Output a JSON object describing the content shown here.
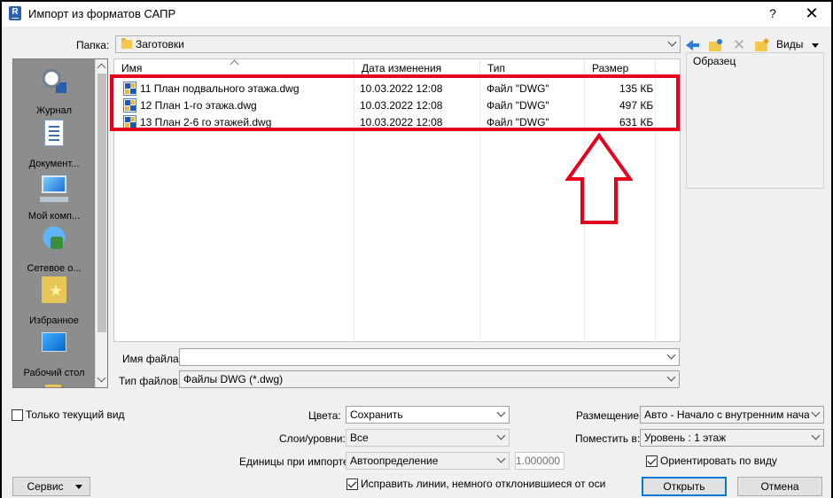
{
  "window": {
    "title": "Импорт из форматов САПР",
    "app_icon_letter": "R",
    "help_symbol": "?",
    "close_symbol": "✕"
  },
  "folder_bar": {
    "label": "Папка:",
    "value": "Заготовки",
    "views_label": "Виды"
  },
  "places": [
    {
      "label": "Журнал",
      "icon": "history-icon"
    },
    {
      "label": "Документ...",
      "icon": "documents-icon"
    },
    {
      "label": "Мой комп...",
      "icon": "computer-icon"
    },
    {
      "label": "Сетевое о...",
      "icon": "network-icon"
    },
    {
      "label": "Избранное",
      "icon": "favorites-icon"
    },
    {
      "label": "Рабочий стол",
      "icon": "desktop-icon"
    }
  ],
  "file_list": {
    "columns": [
      "Имя",
      "Дата изменения",
      "Тип",
      "Размер"
    ],
    "rows": [
      {
        "name": "11 План подвального этажа.dwg",
        "date": "10.03.2022 12:08",
        "type": "Файл \"DWG\"",
        "size": "135 КБ"
      },
      {
        "name": "12 План 1-го этажа.dwg",
        "date": "10.03.2022 12:08",
        "type": "Файл \"DWG\"",
        "size": "497 КБ"
      },
      {
        "name": "13 План 2-6 го этажей.dwg",
        "date": "10.03.2022 12:08",
        "type": "Файл \"DWG\"",
        "size": "631 КБ"
      }
    ]
  },
  "preview": {
    "label": "Образец"
  },
  "filename": {
    "label": "Имя файла:",
    "value": ""
  },
  "filetype": {
    "label": "Тип файлов:",
    "value": "Файлы DWG  (*.dwg)"
  },
  "options": {
    "current_view_only": {
      "label": "Только текущий вид",
      "checked": false
    },
    "colors": {
      "label": "Цвета:",
      "value": "Сохранить"
    },
    "layers": {
      "label": "Слои/уровни:",
      "value": "Все"
    },
    "units": {
      "label": "Единицы при импорте:",
      "value": "Автоопределение",
      "scale": "1.000000"
    },
    "fix_lines": {
      "label": "Исправить линии, немного отклонившиеся от оси",
      "checked": true
    },
    "placement": {
      "label": "Размещение:",
      "value": "Авто - Начало с внутренним началом"
    },
    "place_at": {
      "label": "Поместить в:",
      "value": "Уровень : 1 этаж"
    },
    "orient_to_view": {
      "label": "Ориентировать по виду",
      "checked": true
    }
  },
  "buttons": {
    "service": "Сервис",
    "open": "Открыть",
    "cancel": "Отмена"
  },
  "annotation": {
    "highlight_color": "#e5001c"
  }
}
